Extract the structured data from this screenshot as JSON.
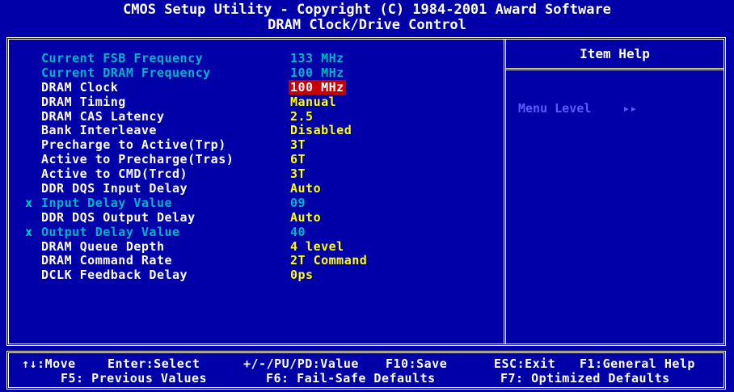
{
  "header": {
    "line1": "CMOS Setup Utility - Copyright (C) 1984-2001 Award Software",
    "line2": "DRAM Clock/Drive Control"
  },
  "settings": [
    {
      "mark": "",
      "label": "Current FSB Frequency",
      "value": "133 MHz",
      "state": "info"
    },
    {
      "mark": "",
      "label": "Current DRAM Frequency",
      "value": "100 MHz",
      "state": "info"
    },
    {
      "mark": "",
      "label": "DRAM Clock",
      "value": "100 MHz",
      "state": "selected"
    },
    {
      "mark": "",
      "label": "DRAM Timing",
      "value": "Manual",
      "state": "normal"
    },
    {
      "mark": "",
      "label": "DRAM CAS Latency",
      "value": "2.5",
      "state": "normal"
    },
    {
      "mark": "",
      "label": "Bank Interleave",
      "value": "Disabled",
      "state": "normal"
    },
    {
      "mark": "",
      "label": "Precharge to Active(Trp)",
      "value": "3T",
      "state": "normal"
    },
    {
      "mark": "",
      "label": "Active to Precharge(Tras)",
      "value": "6T",
      "state": "normal"
    },
    {
      "mark": "",
      "label": "Active to CMD(Trcd)",
      "value": "3T",
      "state": "normal"
    },
    {
      "mark": "",
      "label": "DDR DQS Input Delay",
      "value": "Auto",
      "state": "normal"
    },
    {
      "mark": "x",
      "label": "Input Delay Value",
      "value": "09",
      "state": "disabled"
    },
    {
      "mark": "",
      "label": "DDR DQS Output Delay",
      "value": "Auto",
      "state": "normal"
    },
    {
      "mark": "x",
      "label": "Output Delay Value",
      "value": "40",
      "state": "disabled"
    },
    {
      "mark": "",
      "label": "DRAM Queue Depth",
      "value": "4 level",
      "state": "normal"
    },
    {
      "mark": "",
      "label": "DRAM Command Rate",
      "value": "2T Command",
      "state": "normal"
    },
    {
      "mark": "",
      "label": "DCLK Feedback Delay",
      "value": "0ps",
      "state": "normal"
    }
  ],
  "help": {
    "title": "Item Help",
    "menu_level_label": "Menu Level",
    "menu_level_value": "▸▸"
  },
  "footer": {
    "move": "↑↓:Move",
    "enter": "Enter:Select",
    "value": "+/-/PU/PD:Value",
    "save": "F10:Save",
    "exit": "ESC:Exit",
    "help": "F1:General Help",
    "prev": "F5: Previous Values",
    "failsafe": "F6: Fail-Safe Defaults",
    "optimized": "F7: Optimized Defaults"
  },
  "colors": {
    "background": "#0000a8",
    "value": "#ffff00",
    "label": "#ffffff",
    "disabled": "#00b4c8",
    "highlight": "#c80000"
  }
}
